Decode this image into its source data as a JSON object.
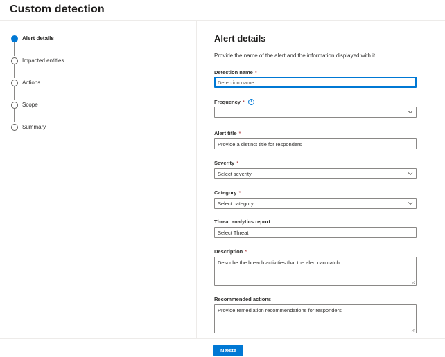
{
  "page": {
    "title": "Custom detection"
  },
  "steps": [
    {
      "label": "Alert details",
      "active": true
    },
    {
      "label": "Impacted entities",
      "active": false
    },
    {
      "label": "Actions",
      "active": false
    },
    {
      "label": "Scope",
      "active": false
    },
    {
      "label": "Summary",
      "active": false
    }
  ],
  "form": {
    "title": "Alert details",
    "description": "Provide the name of the alert and the information displayed with it.",
    "required_marker": "*",
    "info_icon": "i",
    "detection_name": {
      "label": "Detection name",
      "placeholder": "Detection name",
      "value": ""
    },
    "frequency": {
      "label": "Frequency",
      "value": ""
    },
    "alert_title": {
      "label": "Alert title",
      "placeholder": "Provide a distinct title for responders"
    },
    "severity": {
      "label": "Severity",
      "placeholder": "Select severity"
    },
    "category": {
      "label": "Category",
      "placeholder": "Select category"
    },
    "threat_report": {
      "label": "Threat analytics report",
      "placeholder": "Select Threat"
    },
    "description_field": {
      "label": "Description",
      "placeholder": "Describe the breach activities that the alert can catch"
    },
    "recommended_actions": {
      "label": "Recommended actions",
      "placeholder": "Provide remediation recommendations for responders"
    }
  },
  "footer": {
    "next_label": "Næste"
  },
  "colors": {
    "accent": "#0078d4",
    "required": "#a4262c",
    "border": "#8a8886"
  }
}
